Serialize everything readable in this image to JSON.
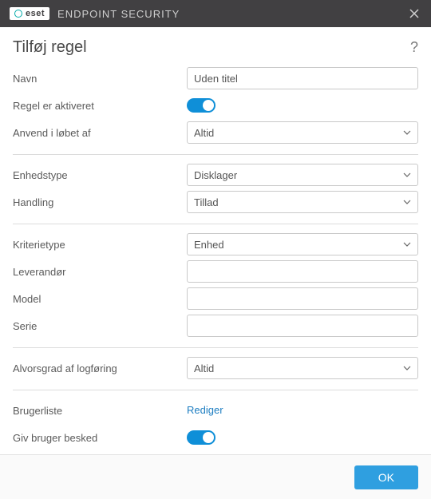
{
  "app": {
    "brand": "eset",
    "name": "ENDPOINT SECURITY"
  },
  "page": {
    "title": "Tilføj regel"
  },
  "fields": {
    "name_label": "Navn",
    "name_value": "Uden titel",
    "activated_label": "Regel er aktiveret",
    "apply_during_label": "Anvend i løbet af",
    "apply_during_value": "Altid",
    "device_type_label": "Enhedstype",
    "device_type_value": "Disklager",
    "action_label": "Handling",
    "action_value": "Tillad",
    "criteria_type_label": "Kriterietype",
    "criteria_type_value": "Enhed",
    "vendor_label": "Leverandør",
    "vendor_value": "",
    "model_label": "Model",
    "model_value": "",
    "serial_label": "Serie",
    "serial_value": "",
    "log_severity_label": "Alvorsgrad af logføring",
    "log_severity_value": "Altid",
    "user_list_label": "Brugerliste",
    "user_list_action": "Rediger",
    "notify_user_label": "Giv bruger besked"
  },
  "buttons": {
    "ok": "OK"
  }
}
